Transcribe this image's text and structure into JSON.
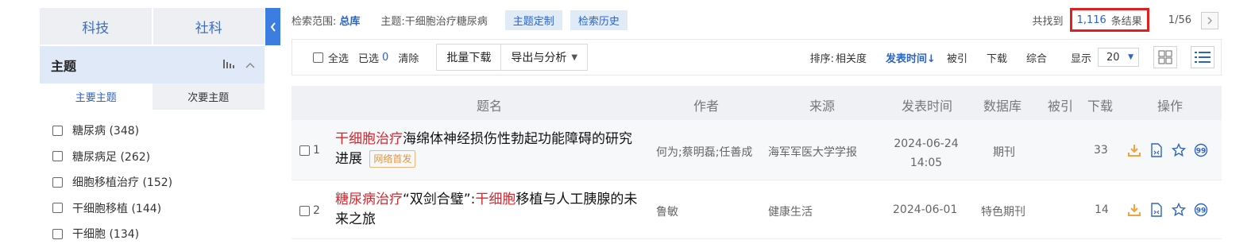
{
  "left_panel": {
    "tabs": [
      "科技",
      "社科"
    ],
    "facet_title": "主题",
    "subtabs": [
      "主要主题",
      "次要主题"
    ],
    "items": [
      {
        "label": "糖尿病 (348)"
      },
      {
        "label": "糖尿病足 (262)"
      },
      {
        "label": "细胞移植治疗 (152)"
      },
      {
        "label": "干细胞移植 (144)"
      },
      {
        "label": "干细胞 (134)"
      }
    ]
  },
  "search_info": {
    "scope_label": "检索范围:",
    "scope_value": "总库",
    "topic": "主题:干细胞治疗糖尿病",
    "btn_customize": "主题定制",
    "btn_history": "检索历史",
    "found_prefix": "共找到",
    "found_count": "1,116",
    "found_suffix": "条结果",
    "pagination": "1/56"
  },
  "toolbar": {
    "select_all": "全选",
    "selected_label": "已选",
    "selected_count": "0",
    "clear": "清除",
    "batch_download": "批量下载",
    "export_analyze": "导出与分析",
    "sort_label": "排序:",
    "sort_options": [
      "相关度",
      "发表时间↓",
      "被引",
      "下载",
      "综合"
    ],
    "display_label": "显示",
    "page_size": "20"
  },
  "table": {
    "columns": [
      "题名",
      "作者",
      "来源",
      "发表时间",
      "数据库",
      "被引",
      "下载",
      "操作"
    ],
    "rows": [
      {
        "index": "1",
        "title_hl": "干细胞治疗",
        "title_rest": "海绵体神经损伤性勃起功能障碍的研究进展",
        "badge": "网络首发",
        "author": "何为;蔡明磊;任善成",
        "source": "海军军医大学学报",
        "date": "2024-06-24",
        "time": "14:05",
        "db": "期刊",
        "cited": "",
        "downloads": "33"
      },
      {
        "index": "2",
        "title_hl": "糖尿病治疗",
        "title_mid": "“双剑合璧”:",
        "title_hl2": "干细胞",
        "title_rest": "移植与人工胰腺的未来之旅",
        "author": "鲁敏",
        "source": "健康生活",
        "date": "2024-06-01",
        "db": "特色期刊",
        "cited": "",
        "downloads": "14"
      }
    ]
  },
  "colors": {
    "accent": "#2b64c4",
    "highlight": "#d9262e",
    "found_border": "#e02020",
    "download_icon": "#f2a33a"
  }
}
